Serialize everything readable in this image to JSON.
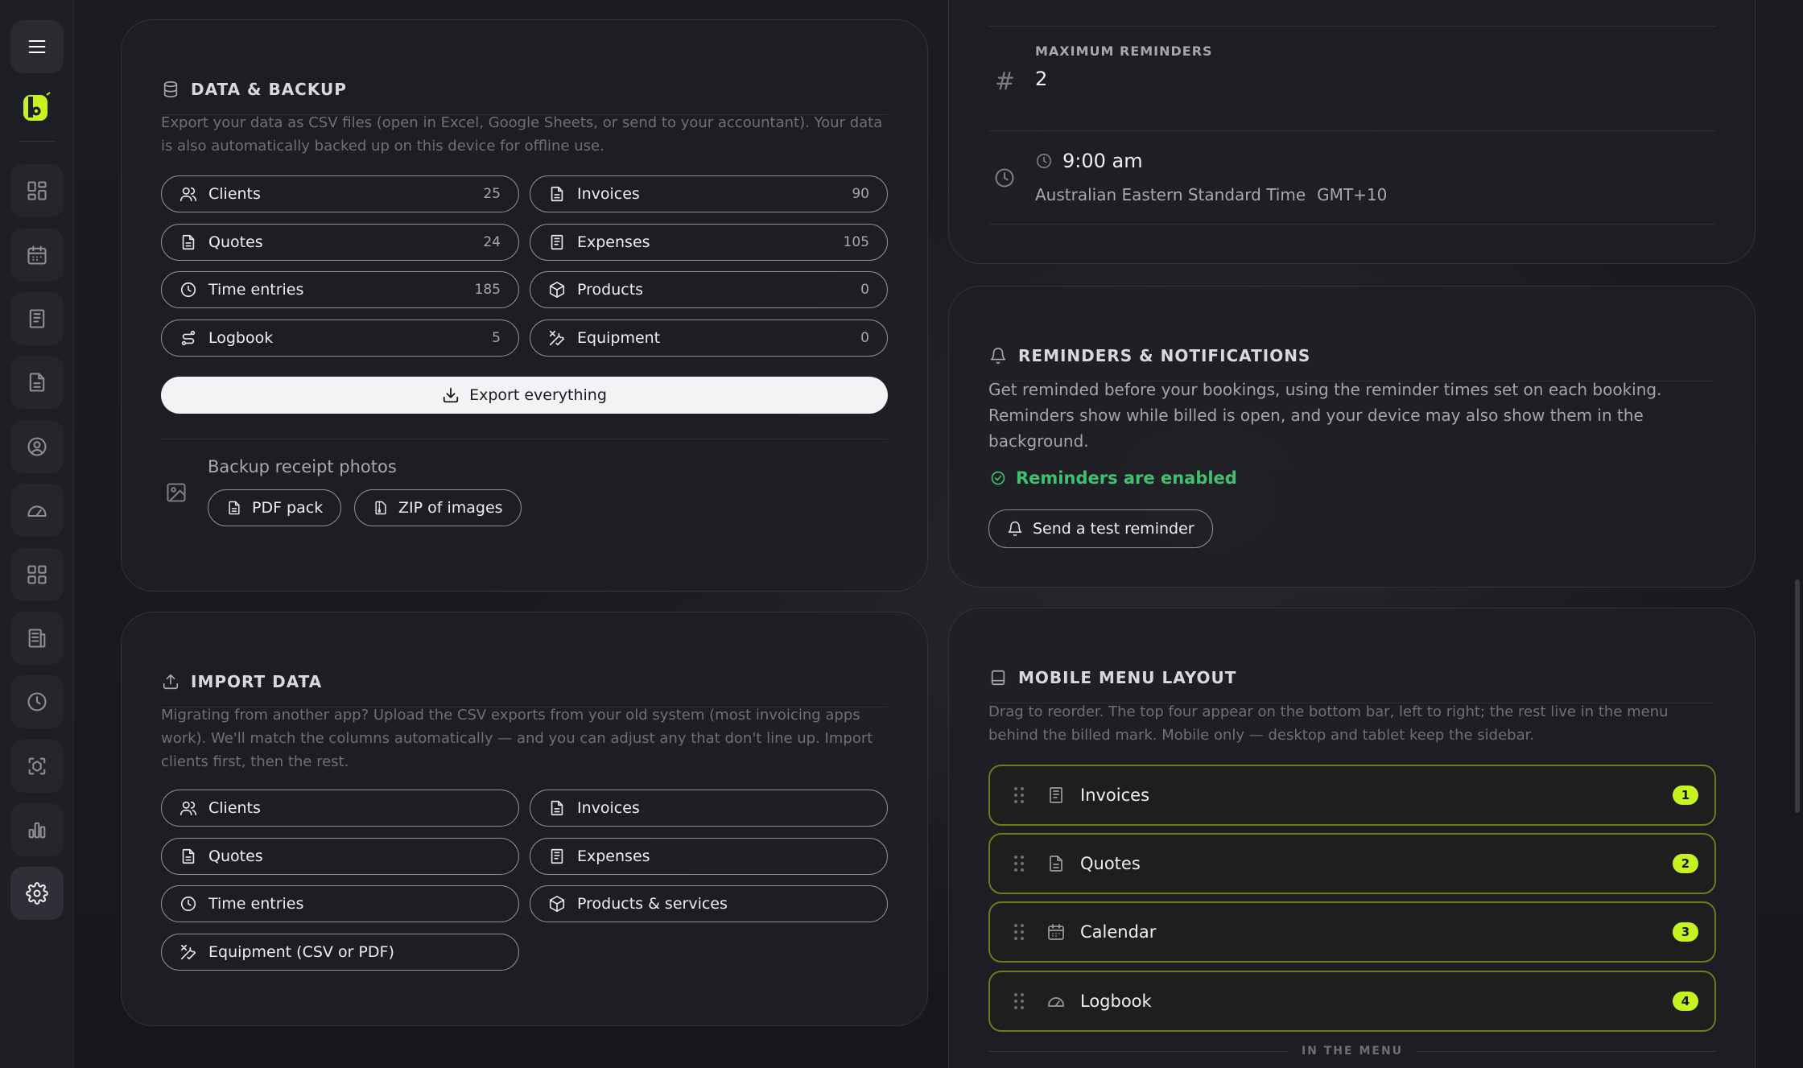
{
  "sidebar": {
    "items": [
      {
        "name": "menu",
        "icon": "hamburger-icon"
      },
      {
        "name": "dashboard",
        "icon": "grid-icon"
      },
      {
        "name": "calendar",
        "icon": "calendar-icon"
      },
      {
        "name": "invoices",
        "icon": "invoice-icon"
      },
      {
        "name": "quotes",
        "icon": "document-icon"
      },
      {
        "name": "clients",
        "icon": "user-circle-icon"
      },
      {
        "name": "logbook",
        "icon": "gauge-icon"
      },
      {
        "name": "products",
        "icon": "apps-icon"
      },
      {
        "name": "expenses",
        "icon": "receipt-icon"
      },
      {
        "name": "time",
        "icon": "clock-icon"
      },
      {
        "name": "equipment",
        "icon": "scan-icon"
      },
      {
        "name": "reports",
        "icon": "bar-chart-icon"
      },
      {
        "name": "settings",
        "icon": "gear-icon",
        "active": true
      }
    ],
    "accent": "#c6f222"
  },
  "data_backup": {
    "title": "DATA & BACKUP",
    "description": "Export your data as CSV files (open in Excel, Google Sheets, or send to your accountant). Your data is also automatically backed up on this device for offline use.",
    "exports": [
      {
        "label": "Clients",
        "count": "25",
        "icon": "users-icon"
      },
      {
        "label": "Invoices",
        "count": "90",
        "icon": "invoice-icon"
      },
      {
        "label": "Quotes",
        "count": "24",
        "icon": "document-icon"
      },
      {
        "label": "Expenses",
        "count": "105",
        "icon": "receipt-icon"
      },
      {
        "label": "Time entries",
        "count": "185",
        "icon": "clock-icon"
      },
      {
        "label": "Products",
        "count": "0",
        "icon": "box-icon"
      },
      {
        "label": "Logbook",
        "count": "5",
        "icon": "route-icon"
      },
      {
        "label": "Equipment",
        "count": "0",
        "icon": "tools-icon"
      }
    ],
    "export_all_label": "Export everything",
    "receipts_label": "Backup receipt photos",
    "pdf_pack_label": "PDF pack",
    "zip_label": "ZIP of images"
  },
  "import_data": {
    "title": "IMPORT DATA",
    "description": "Migrating from another app? Upload the CSV exports from your old system (most invoicing apps work). We'll match the columns automatically — and you can adjust any that don't line up. Import clients first, then the rest.",
    "items": [
      {
        "label": "Clients",
        "icon": "users-icon"
      },
      {
        "label": "Invoices",
        "icon": "invoice-icon"
      },
      {
        "label": "Quotes",
        "icon": "document-icon"
      },
      {
        "label": "Expenses",
        "icon": "receipt-icon"
      },
      {
        "label": "Time entries",
        "icon": "clock-icon"
      },
      {
        "label": "Products & services",
        "icon": "box-icon"
      },
      {
        "label": "Equipment (CSV or PDF)",
        "icon": "tools-icon"
      }
    ]
  },
  "reminder_settings": {
    "max_label": "MAXIMUM REMINDERS",
    "max_value": "2",
    "time": "9:00 am",
    "timezone": "Australian Eastern Standard Time",
    "gmt": "GMT+10"
  },
  "notifications": {
    "title": "REMINDERS & NOTIFICATIONS",
    "description": "Get reminded before your bookings, using the reminder times set on each booking. Reminders show while billed is open, and your device may also show them in the background.",
    "status": "Reminders are enabled",
    "status_color": "#3ec26d",
    "test_button": "Send a test reminder"
  },
  "mobile_menu": {
    "title": "MOBILE MENU LAYOUT",
    "description": "Drag to reorder. The top four appear on the bottom bar, left to right; the rest live in the menu behind the billed mark. Mobile only — desktop and tablet keep the sidebar.",
    "items": [
      {
        "label": "Invoices",
        "badge": "1",
        "icon": "invoice-icon"
      },
      {
        "label": "Quotes",
        "badge": "2",
        "icon": "document-icon"
      },
      {
        "label": "Calendar",
        "badge": "3",
        "icon": "calendar-icon"
      },
      {
        "label": "Logbook",
        "badge": "4",
        "icon": "gauge-icon"
      }
    ],
    "in_menu_label": "IN THE MENU"
  }
}
